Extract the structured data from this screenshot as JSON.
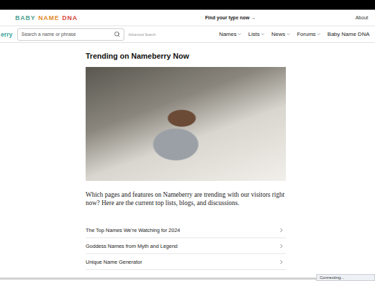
{
  "promo_bar": {
    "logo": [
      {
        "text": "BABY",
        "color": "#4a9d8f"
      },
      {
        "text": "NAME",
        "color": "#e28a2b"
      },
      {
        "text": "DNA",
        "color": "#d6453d"
      }
    ],
    "cta": "Find your type now",
    "cta_arrow": "→",
    "link": "About"
  },
  "nav": {
    "logo": "erry",
    "search_placeholder": "Search a name or phrase",
    "advanced_search": "Advanced Search",
    "items": [
      {
        "label": "Names",
        "has_menu": true
      },
      {
        "label": "Lists",
        "has_menu": true
      },
      {
        "label": "News",
        "has_menu": true
      },
      {
        "label": "Forums",
        "has_menu": true
      },
      {
        "label": "Baby Name DNA",
        "has_menu": false
      }
    ]
  },
  "page": {
    "title": "Trending on Nameberry Now",
    "intro": "Which pages and features on Nameberry are trending with our visitors right now? Here are the current top lists, blogs, and discussions.",
    "links": [
      {
        "label": "The Top Names We're Watching for 2024"
      },
      {
        "label": "Goddess Names from Myth and Legend"
      },
      {
        "label": "Unique Name Generator"
      }
    ]
  },
  "status_bar": {
    "text": "Connecting..."
  }
}
